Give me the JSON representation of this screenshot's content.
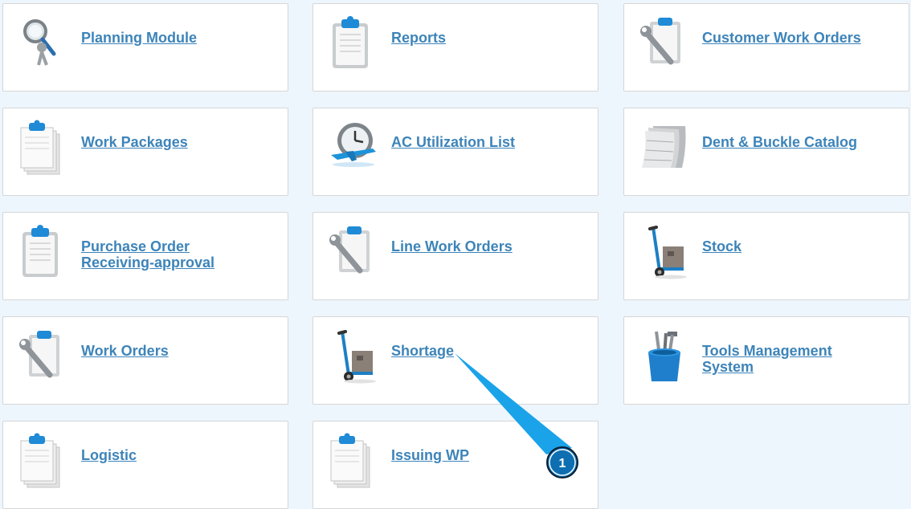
{
  "tiles": [
    {
      "label": "Planning Module",
      "icon": "magnifier-figure-icon"
    },
    {
      "label": "Reports",
      "icon": "clipboard-icon"
    },
    {
      "label": "Customer Work Orders",
      "icon": "wrench-clipboard-icon"
    },
    {
      "label": "Work Packages",
      "icon": "document-stack-icon"
    },
    {
      "label": "AC Utilization List",
      "icon": "clock-airplane-icon"
    },
    {
      "label": "Dent & Buckle Catalog",
      "icon": "metal-sheets-icon"
    },
    {
      "label": "Purchase Order\nReceiving-approval",
      "icon": "clipboard-icon"
    },
    {
      "label": "Line Work Orders",
      "icon": "wrench-clipboard-icon"
    },
    {
      "label": "Stock",
      "icon": "hand-truck-icon"
    },
    {
      "label": "Work Orders",
      "icon": "wrench-clipboard-icon"
    },
    {
      "label": "Shortage",
      "icon": "hand-truck-icon"
    },
    {
      "label": "Tools Management\nSystem",
      "icon": "tool-bucket-icon"
    },
    {
      "label": "Logistic",
      "icon": "document-stack-icon"
    },
    {
      "label": "Issuing WP",
      "icon": "document-stack-icon"
    }
  ],
  "annotation": {
    "badge": "1"
  },
  "colors": {
    "link": "#3d84b9",
    "callout": "#1aa3e8",
    "background": "#eef6fd"
  }
}
